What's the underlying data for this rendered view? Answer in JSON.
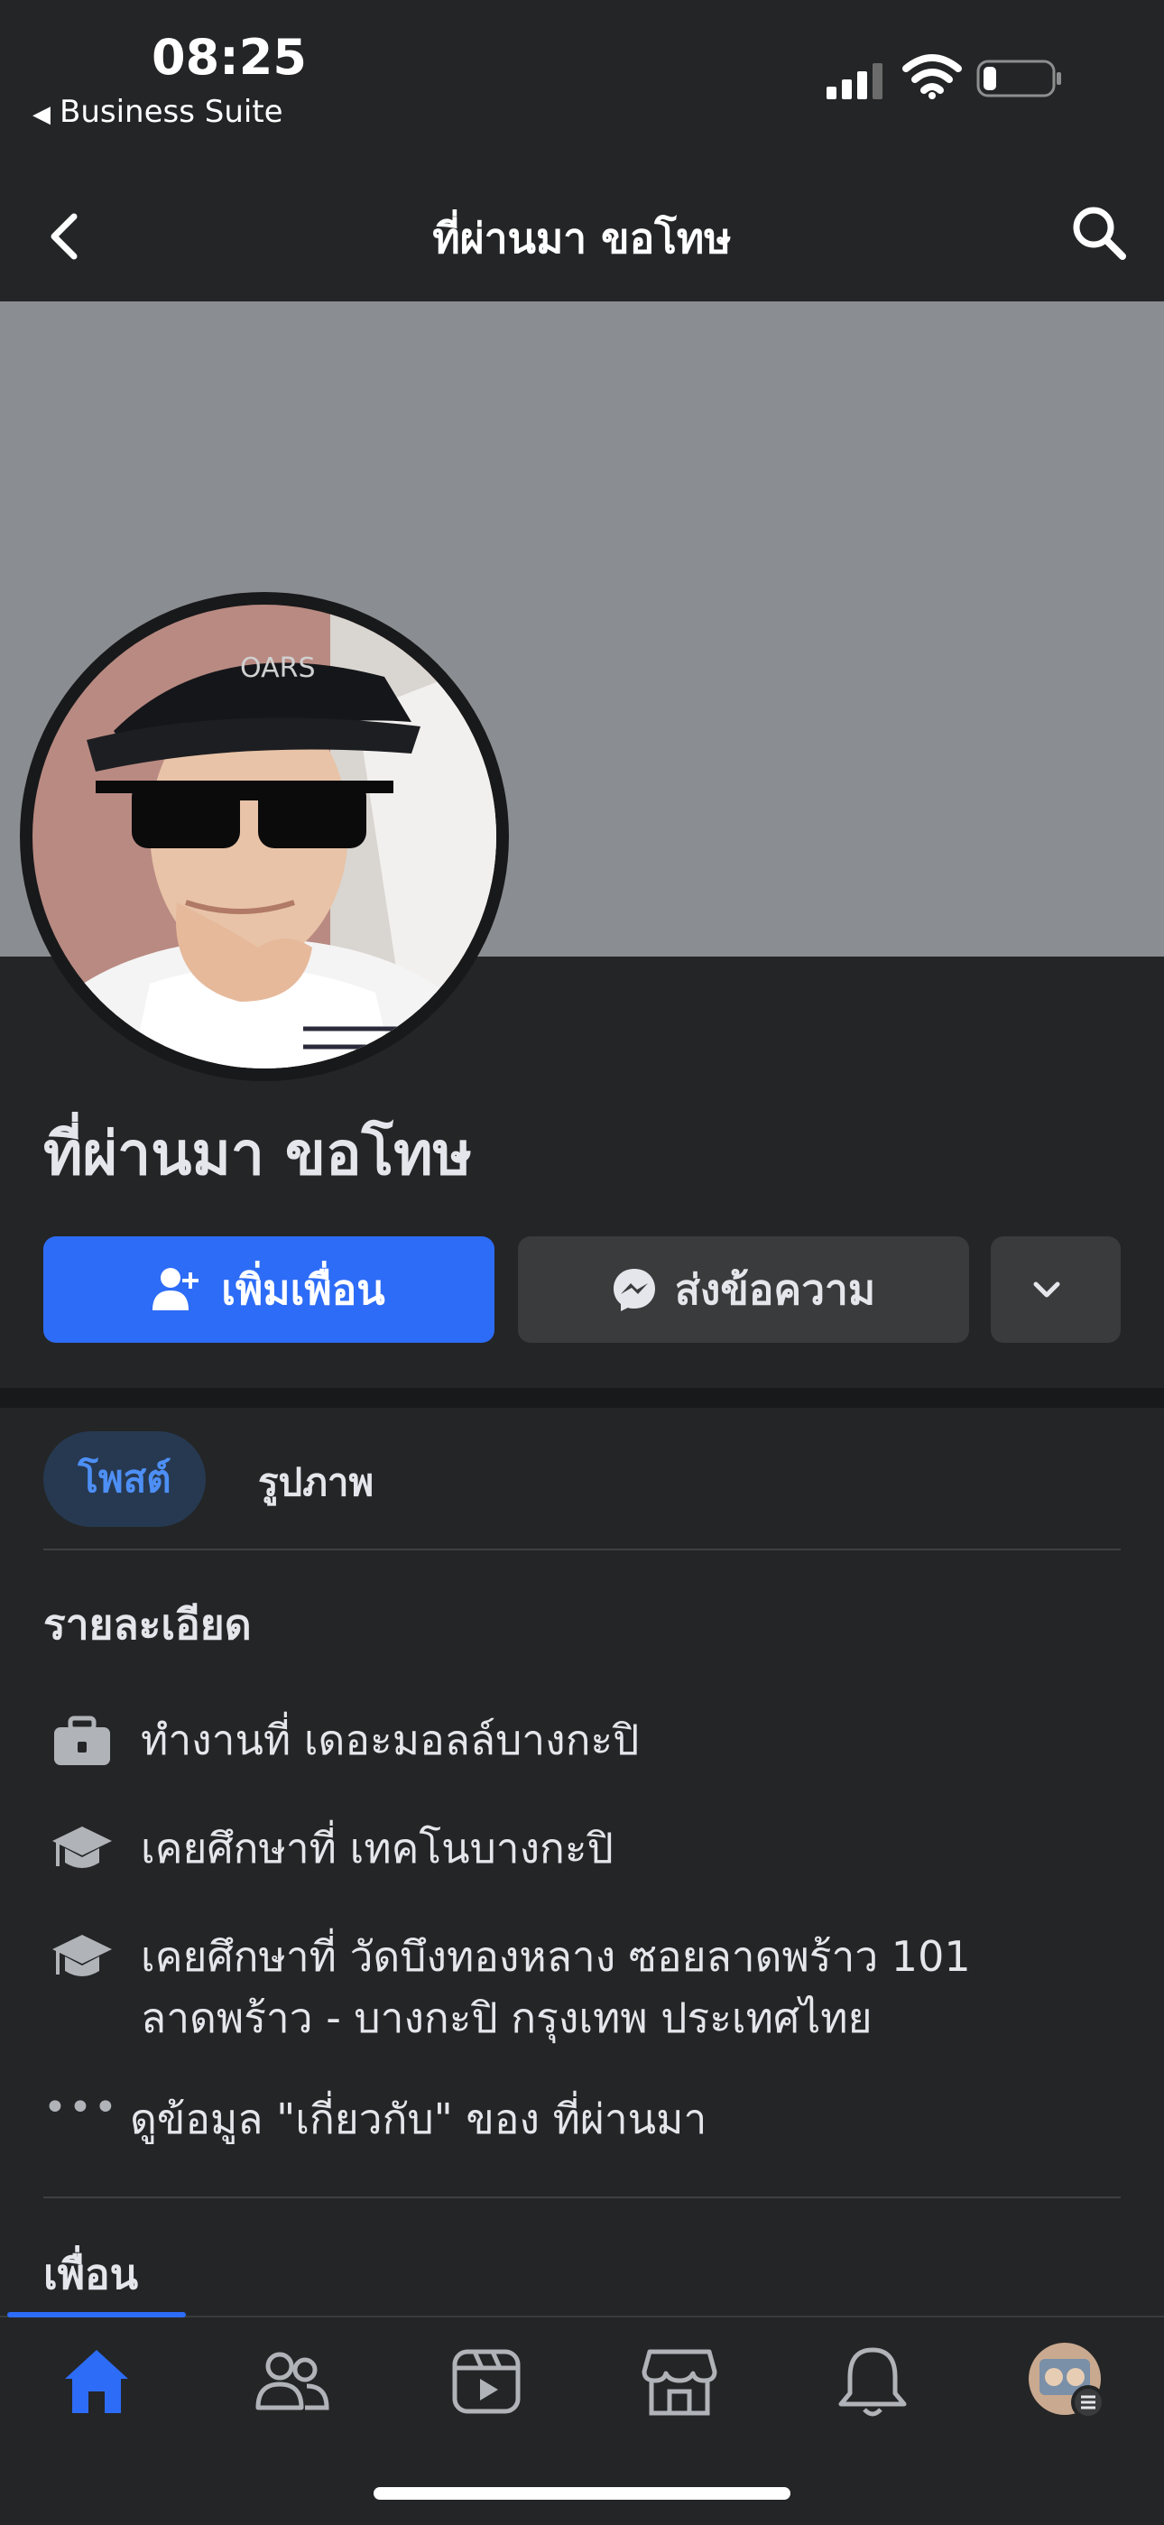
{
  "status_bar": {
    "time": "08:25",
    "back_app_label": "Business Suite",
    "battery_level": 0.2
  },
  "nav": {
    "title": "ที่ผ่านมา ขอโทษ"
  },
  "profile": {
    "name": "ที่ผ่านมา ขอโทษ"
  },
  "actions": {
    "add_friend": "เพิ่มเพื่อน",
    "message": "ส่งข้อความ"
  },
  "tabs": {
    "posts": "โพสต์",
    "photos": "รูปภาพ"
  },
  "details": {
    "title": "รายละเอียด",
    "work": "ทำงานที่ เดอะมอลล์บางกะปิ",
    "education_1": "เคยศึกษาที่ เทคโนบางกะปิ",
    "education_2_line1": "เคยศึกษาที่ วัดบึงทองหลาง ซอยลาดพร้าว 101",
    "education_2_line2": "ลาดพร้าว - บางกะปิ กรุงเทพ ประเทศไทย",
    "more_dots": "•••",
    "see_about": "ดูข้อมูล \"เกี่ยวกับ\" ของ ที่ผ่านมา"
  },
  "friends": {
    "title": "เพื่อน"
  },
  "colors": {
    "accent": "#2d6cf6",
    "background": "#242526",
    "cover": "#8a8d91"
  },
  "bottom_tabs": [
    "home-icon",
    "friends-icon",
    "watch-icon",
    "marketplace-icon",
    "notifications-icon",
    "menu-avatar-icon"
  ]
}
